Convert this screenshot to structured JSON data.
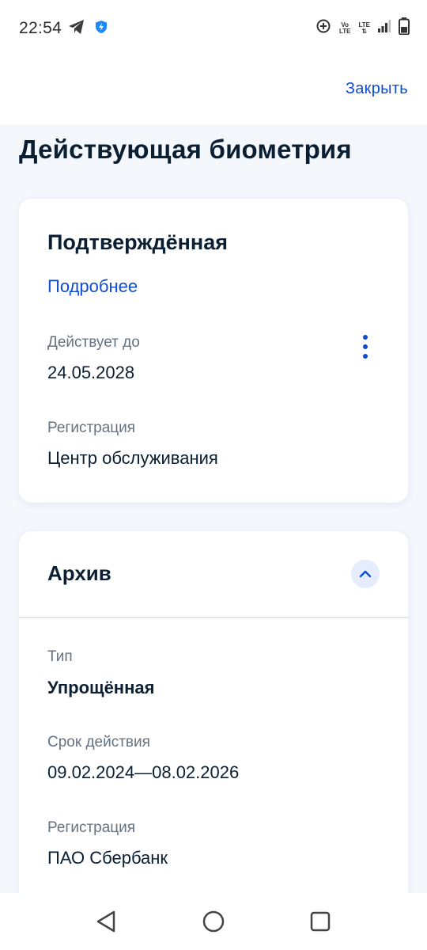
{
  "status_bar": {
    "time": "22:54",
    "left_icons": [
      "telegram-icon",
      "shield-icon"
    ],
    "right_icons": [
      "data-saver-icon",
      "volte-icon",
      "lte-icon",
      "signal-icon",
      "battery-icon"
    ],
    "volte_top": "Vo",
    "volte_bottom": "LTE",
    "lte_text": "LTE"
  },
  "header": {
    "close_label": "Закрыть"
  },
  "page": {
    "title": "Действующая биометрия"
  },
  "current_card": {
    "title": "Подтверждённая",
    "details_link": "Подробнее",
    "valid_until_label": "Действует до",
    "valid_until_value": "24.05.2028",
    "registration_label": "Регистрация",
    "registration_value": "Центр обслуживания"
  },
  "archive_card": {
    "title": "Архив",
    "type_label": "Тип",
    "type_value": "Упрощённая",
    "period_label": "Срок действия",
    "period_value": "09.02.2024—08.02.2026",
    "registration_label": "Регистрация",
    "registration_value": "ПАО Сбербанк"
  },
  "colors": {
    "accent": "#0d4cd3",
    "text": "#0b1f33",
    "secondary_text": "#66727f",
    "background": "#f4f7fc"
  },
  "nav_bar": {
    "icons": [
      "back-icon",
      "home-icon",
      "recents-icon"
    ]
  }
}
